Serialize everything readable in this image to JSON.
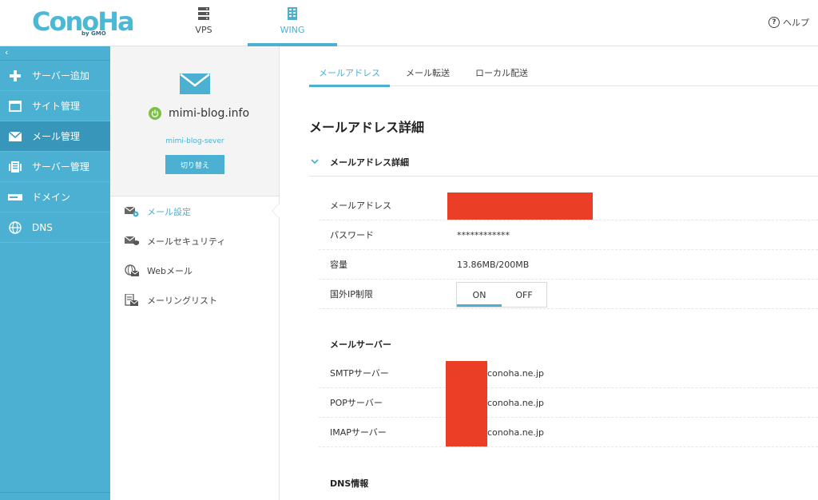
{
  "header": {
    "logo_text": "ConoHa",
    "logo_sub": "by GMO",
    "tabs": [
      {
        "label": "VPS",
        "icon": "server-stack-icon"
      },
      {
        "label": "WING",
        "icon": "building-icon"
      }
    ],
    "help_label": "ヘルプ"
  },
  "sidebar": {
    "collapse_glyph": "‹",
    "items": [
      {
        "label": "サーバー追加",
        "icon": "plus-icon"
      },
      {
        "label": "サイト管理",
        "icon": "window-icon"
      },
      {
        "label": "メール管理",
        "icon": "mail-icon"
      },
      {
        "label": "サーバー管理",
        "icon": "server-icon"
      },
      {
        "label": "ドメイン",
        "icon": "domain-icon"
      },
      {
        "label": "DNS",
        "icon": "globe-icon"
      }
    ]
  },
  "panel": {
    "domain": "mimi-blog.info",
    "server_name": "mimi-blog-sever",
    "switch_label": "切り替え",
    "menu": [
      {
        "label": "メール設定",
        "icon": "mail-settings-icon"
      },
      {
        "label": "メールセキュリティ",
        "icon": "mail-shield-icon"
      },
      {
        "label": "Webメール",
        "icon": "webmail-icon"
      },
      {
        "label": "メーリングリスト",
        "icon": "mailing-list-icon"
      }
    ]
  },
  "content": {
    "tabs": [
      "メールアドレス",
      "メール転送",
      "ローカル配送"
    ],
    "title": "メールアドレス詳細",
    "section_label": "メールアドレス詳細",
    "fields": {
      "address_label": "メールアドレス",
      "password_label": "パスワード",
      "password_value": "************",
      "capacity_label": "容量",
      "capacity_value": "13.86MB/200MB",
      "ip_limit_label": "国外IP制限",
      "ip_on": "ON",
      "ip_off": "OFF"
    },
    "mail_server_head": "メールサーバー",
    "servers": {
      "smtp_label": "SMTPサーバー",
      "smtp_value": "conoha.ne.jp",
      "pop_label": "POPサーバー",
      "pop_value": "conoha.ne.jp",
      "imap_label": "IMAPサーバー",
      "imap_value": "conoha.ne.jp"
    },
    "dns_head": "DNS情報"
  }
}
